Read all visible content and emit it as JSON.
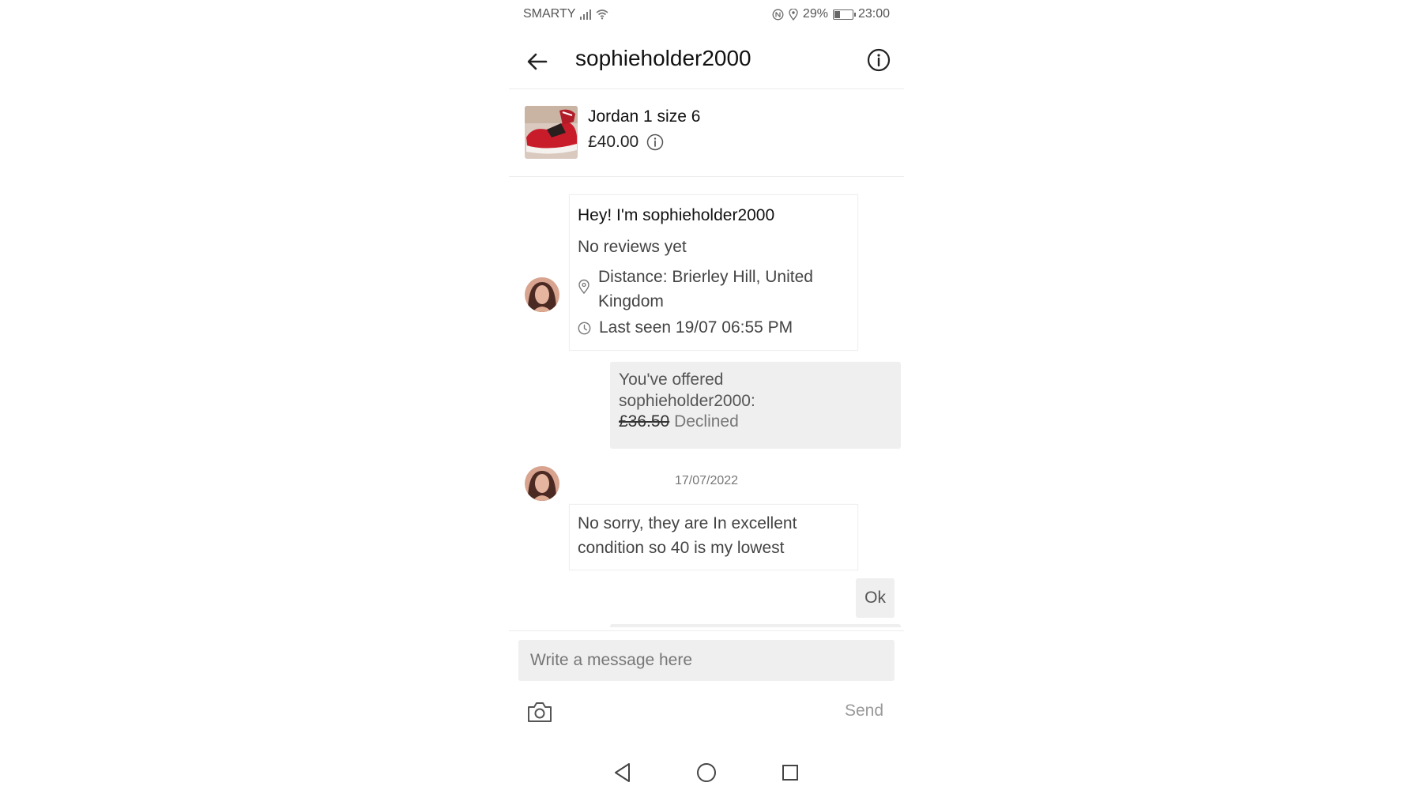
{
  "status_bar": {
    "carrier": "SMARTY",
    "battery": "29%",
    "time": "23:00",
    "icons": [
      "signal-icon",
      "wifi-icon",
      "nfc-icon",
      "location-icon",
      "battery-icon"
    ]
  },
  "header": {
    "title": "sophieholder2000",
    "back_icon": "back-arrow-icon",
    "info_icon": "info-icon"
  },
  "item": {
    "title": "Jordan 1 size 6",
    "price": "£40.00",
    "thumb_icon": "sneaker-thumbnail",
    "price_info_icon": "info-icon"
  },
  "profile_card": {
    "greeting": "Hey! I'm sophieholder2000",
    "reviews": "No reviews yet",
    "distance": "Distance: Brierley Hill, United Kingdom",
    "last_seen": "Last seen 19/07 06:55 PM"
  },
  "offer": {
    "line1": "You've offered",
    "line2": "sophieholder2000:",
    "amount": "£36.50",
    "status": "Declined"
  },
  "date_separator": "17/07/2022",
  "messages": [
    {
      "from": "seller",
      "text": "No sorry, they are In excellent condition so 40 is my lowest"
    },
    {
      "from": "me",
      "text": "Ok"
    }
  ],
  "composer": {
    "placeholder": "Write a message here",
    "send_label": "Send",
    "camera_icon": "camera-icon"
  },
  "navbar": {
    "icons": [
      "nav-back-icon",
      "nav-home-icon",
      "nav-recents-icon"
    ]
  },
  "colors": {
    "bubble_bg": "#efefef",
    "text_primary": "#111111",
    "text_secondary": "#444444",
    "muted": "#999999",
    "divider": "#ececec"
  }
}
